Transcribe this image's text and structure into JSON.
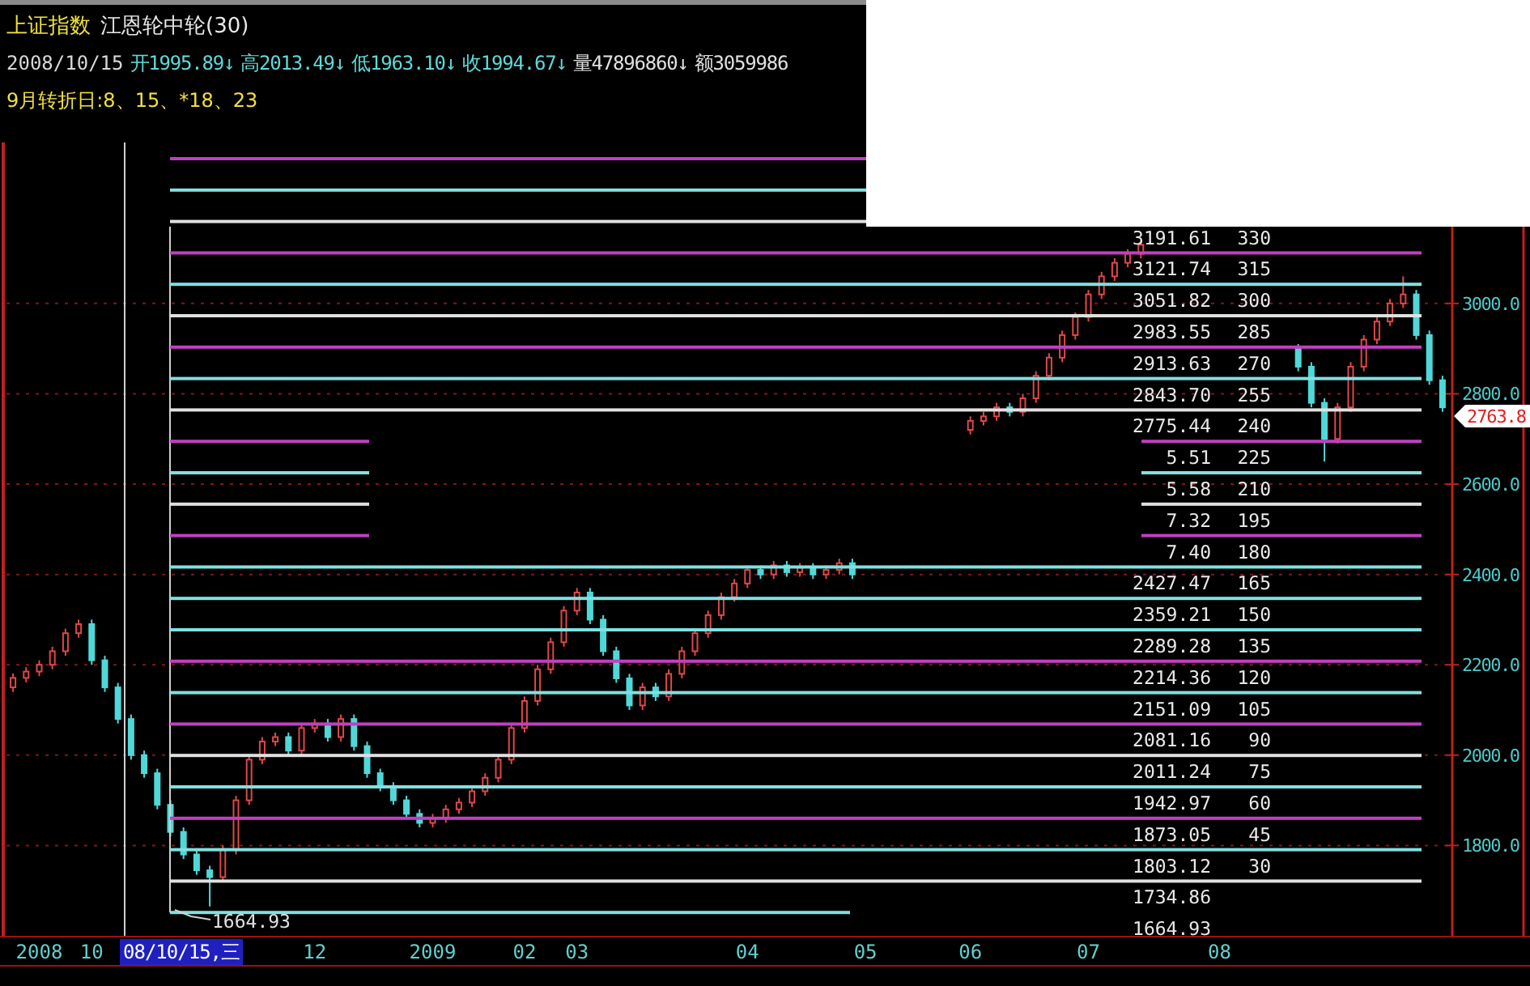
{
  "header": {
    "symbol": "上证指数",
    "indicator": "江恩轮中轮(30)"
  },
  "quote": {
    "date": "2008/10/15",
    "fields": [
      {
        "text": "开1995.89↓",
        "kind": "price"
      },
      {
        "text": "高2013.49↓",
        "kind": "price"
      },
      {
        "text": "低1963.10↓",
        "kind": "price"
      },
      {
        "text": "收1994.67↓",
        "kind": "price"
      },
      {
        "text": "量47896860↓",
        "kind": "volume"
      },
      {
        "text": "额3059986",
        "kind": "volume"
      }
    ]
  },
  "turning_days": "9月转折日:8、15、*18、23",
  "levels": [
    {
      "color": "#c040c0",
      "interrupted": false
    },
    {
      "color": "#80e0e0",
      "interrupted": false
    },
    {
      "color": "#e0e0e0",
      "interrupted": false,
      "price": "3191.61",
      "degree": "330"
    },
    {
      "color": "#c040c0",
      "interrupted": false,
      "price": "3121.74",
      "degree": "315"
    },
    {
      "color": "#80e0e0",
      "interrupted": false,
      "price": "3051.82",
      "degree": "300"
    },
    {
      "color": "#e0e0e0",
      "interrupted": false,
      "price": "2983.55",
      "degree": "285"
    },
    {
      "color": "#c040c0",
      "interrupted": false,
      "price": "2913.63",
      "degree": "270"
    },
    {
      "color": "#80e0e0",
      "interrupted": false,
      "price": "2843.70",
      "degree": "255"
    },
    {
      "color": "#e0e0e0",
      "interrupted": false,
      "price": "2775.44",
      "degree": "240"
    },
    {
      "color": "#c040c0",
      "interrupted": true,
      "price": "5.51",
      "degree": "225"
    },
    {
      "color": "#80e0e0",
      "interrupted": true,
      "price": "5.58",
      "degree": "210"
    },
    {
      "color": "#e0e0e0",
      "interrupted": true,
      "price": "7.32",
      "degree": "195"
    },
    {
      "color": "#c040c0",
      "interrupted": true,
      "price": "7.40",
      "degree": "180"
    },
    {
      "color": "#80e0e0",
      "interrupted": false,
      "price": "2427.47",
      "degree": "165"
    },
    {
      "color": "#80e0e0",
      "interrupted": false,
      "price": "2359.21",
      "degree": "150"
    },
    {
      "color": "#80e0e0",
      "interrupted": false,
      "price": "2289.28",
      "degree": "135"
    },
    {
      "color": "#c040c0",
      "interrupted": false,
      "price": "2214.36",
      "degree": "120"
    },
    {
      "color": "#80e0e0",
      "interrupted": false,
      "price": "2151.09",
      "degree": "105"
    },
    {
      "color": "#c040c0",
      "interrupted": false,
      "price": "2081.16",
      "degree": "90"
    },
    {
      "color": "#e0e0e0",
      "interrupted": false,
      "price": "2011.24",
      "degree": "75"
    },
    {
      "color": "#80e0e0",
      "interrupted": false,
      "price": "1942.97",
      "degree": "60"
    },
    {
      "color": "#c040c0",
      "interrupted": false,
      "price": "1873.05",
      "degree": "45"
    },
    {
      "color": "#80e0e0",
      "interrupted": false,
      "price": "1803.12",
      "degree": "30"
    },
    {
      "color": "#e0e0e0",
      "interrupted": false,
      "price": "1734.86"
    },
    {
      "color": "#80e0e0",
      "interrupted": false,
      "price": "1664.93"
    }
  ],
  "low_marker": "1664.93",
  "chart_data": {
    "type": "candlestick",
    "categories": [
      null,
      null,
      "2008",
      null,
      null,
      null,
      "10",
      null,
      null,
      null,
      null,
      null,
      null,
      null,
      null,
      null,
      null,
      null,
      null,
      null,
      null,
      null,
      null,
      "12",
      null,
      null,
      null,
      null,
      null,
      null,
      null,
      null,
      "2009",
      null,
      null,
      null,
      null,
      null,
      null,
      "02",
      null,
      null,
      null,
      "03",
      null,
      null,
      null,
      null,
      null,
      null,
      null,
      null,
      null,
      null,
      null,
      null,
      "04",
      null,
      null,
      null,
      null,
      null,
      null,
      null,
      null,
      "05",
      null,
      null,
      null,
      null,
      null,
      null,
      null,
      "06",
      null,
      null,
      null,
      null,
      null,
      null,
      null,
      null,
      "07",
      null,
      null,
      null,
      null,
      null,
      null,
      null,
      null,
      null,
      "08",
      null,
      null,
      null,
      null,
      null,
      null,
      null,
      null,
      null,
      null,
      null,
      null,
      null,
      null,
      null,
      null,
      null
    ],
    "ohlc": [
      [
        2150,
        2181,
        2140,
        2171
      ],
      [
        2171,
        2195,
        2161,
        2185
      ],
      [
        2185,
        2210,
        2175,
        2200
      ],
      [
        2200,
        2240,
        2190,
        2230
      ],
      [
        2230,
        2280,
        2220,
        2270
      ],
      [
        2270,
        2300,
        2260,
        2290
      ],
      [
        2290,
        2300,
        2200,
        2210
      ],
      [
        2210,
        2220,
        2140,
        2150
      ],
      [
        2150,
        2160,
        2070,
        2080
      ],
      [
        2080,
        2090,
        1990,
        2000
      ],
      [
        2000,
        2010,
        1950,
        1960
      ],
      [
        1960,
        1970,
        1880,
        1890
      ],
      [
        1890,
        1900,
        1820,
        1830
      ],
      [
        1830,
        1840,
        1770,
        1780
      ],
      [
        1780,
        1790,
        1735,
        1745
      ],
      [
        1745,
        1755,
        1665,
        1730
      ],
      [
        1730,
        1800,
        1720,
        1790
      ],
      [
        1790,
        1910,
        1780,
        1900
      ],
      [
        1900,
        2000,
        1890,
        1990
      ],
      [
        1990,
        2040,
        1980,
        2030
      ],
      [
        2030,
        2050,
        2020,
        2040
      ],
      [
        2040,
        2050,
        2000,
        2010
      ],
      [
        2010,
        2070,
        2000,
        2060
      ],
      [
        2060,
        2080,
        2050,
        2070
      ],
      [
        2070,
        2080,
        2030,
        2040
      ],
      [
        2040,
        2090,
        2030,
        2080
      ],
      [
        2080,
        2090,
        2010,
        2020
      ],
      [
        2020,
        2030,
        1950,
        1960
      ],
      [
        1960,
        1970,
        1920,
        1930
      ],
      [
        1930,
        1940,
        1890,
        1900
      ],
      [
        1900,
        1910,
        1860,
        1870
      ],
      [
        1870,
        1880,
        1840,
        1850
      ],
      [
        1850,
        1870,
        1840,
        1860
      ],
      [
        1860,
        1890,
        1850,
        1880
      ],
      [
        1880,
        1905,
        1870,
        1895
      ],
      [
        1895,
        1930,
        1885,
        1920
      ],
      [
        1920,
        1960,
        1910,
        1950
      ],
      [
        1950,
        2000,
        1940,
        1990
      ],
      [
        1990,
        2070,
        1980,
        2060
      ],
      [
        2060,
        2130,
        2050,
        2120
      ],
      [
        2120,
        2200,
        2110,
        2190
      ],
      [
        2190,
        2260,
        2180,
        2250
      ],
      [
        2250,
        2330,
        2240,
        2320
      ],
      [
        2320,
        2370,
        2310,
        2360
      ],
      [
        2360,
        2370,
        2290,
        2300
      ],
      [
        2300,
        2310,
        2220,
        2230
      ],
      [
        2230,
        2240,
        2160,
        2170
      ],
      [
        2170,
        2180,
        2100,
        2110
      ],
      [
        2110,
        2160,
        2100,
        2150
      ],
      [
        2150,
        2160,
        2120,
        2130
      ],
      [
        2130,
        2190,
        2120,
        2180
      ],
      [
        2180,
        2240,
        2170,
        2230
      ],
      [
        2230,
        2280,
        2220,
        2270
      ],
      [
        2270,
        2320,
        2260,
        2310
      ],
      [
        2310,
        2360,
        2300,
        2350
      ],
      [
        2350,
        2390,
        2340,
        2380
      ],
      [
        2380,
        2420,
        2370,
        2410
      ],
      [
        2410,
        2420,
        2390,
        2400
      ],
      [
        2400,
        2430,
        2390,
        2420
      ],
      [
        2420,
        2430,
        2395,
        2405
      ],
      [
        2405,
        2425,
        2395,
        2415
      ],
      [
        2415,
        2425,
        2390,
        2400
      ],
      [
        2400,
        2420,
        2390,
        2410
      ],
      [
        2410,
        2435,
        2400,
        2425
      ],
      [
        2425,
        2435,
        2390,
        2400
      ],
      null,
      null,
      null,
      null,
      null,
      null,
      null,
      null,
      [
        2720,
        2750,
        2710,
        2740
      ],
      [
        2740,
        2760,
        2730,
        2750
      ],
      [
        2750,
        2780,
        2740,
        2770
      ],
      [
        2770,
        2780,
        2750,
        2760
      ],
      [
        2760,
        2800,
        2750,
        2790
      ],
      [
        2790,
        2850,
        2780,
        2840
      ],
      [
        2840,
        2890,
        2830,
        2880
      ],
      [
        2880,
        2940,
        2870,
        2930
      ],
      [
        2930,
        2980,
        2920,
        2970
      ],
      [
        2970,
        3030,
        2960,
        3020
      ],
      [
        3020,
        3070,
        3010,
        3060
      ],
      [
        3060,
        3100,
        3050,
        3090
      ],
      [
        3090,
        3120,
        3080,
        3110
      ],
      [
        3110,
        3140,
        3100,
        3130
      ],
      null,
      null,
      null,
      null,
      null,
      null,
      null,
      null,
      null,
      null,
      null,
      [
        2900,
        2910,
        2850,
        2860
      ],
      [
        2860,
        2870,
        2770,
        2780
      ],
      [
        2780,
        2790,
        2650,
        2700
      ],
      [
        2700,
        2780,
        2690,
        2770
      ],
      [
        2770,
        2870,
        2760,
        2860
      ],
      [
        2860,
        2930,
        2850,
        2920
      ],
      [
        2920,
        2970,
        2910,
        2960
      ],
      [
        2960,
        3010,
        2950,
        3000
      ],
      [
        3000,
        3060,
        2990,
        3020
      ],
      [
        3020,
        3030,
        2920,
        2930
      ],
      [
        2930,
        2940,
        2820,
        2830
      ],
      [
        2830,
        2840,
        2760,
        2770
      ]
    ],
    "ylim": [
      1600,
      3170
    ],
    "grid": true,
    "yticks": [
      {
        "value": 3000,
        "label": "3000.0"
      },
      {
        "value": 2800,
        "label": "2800.0"
      },
      {
        "value": 2600,
        "label": "2600.0"
      },
      {
        "value": 2400,
        "label": "2400.0"
      },
      {
        "value": 2200,
        "label": "2200.0"
      },
      {
        "value": 2000,
        "label": "2000.0"
      },
      {
        "value": 1800,
        "label": "1800.0"
      }
    ]
  },
  "current_price": "2763.8",
  "cursor_date": "08/10/15,三"
}
